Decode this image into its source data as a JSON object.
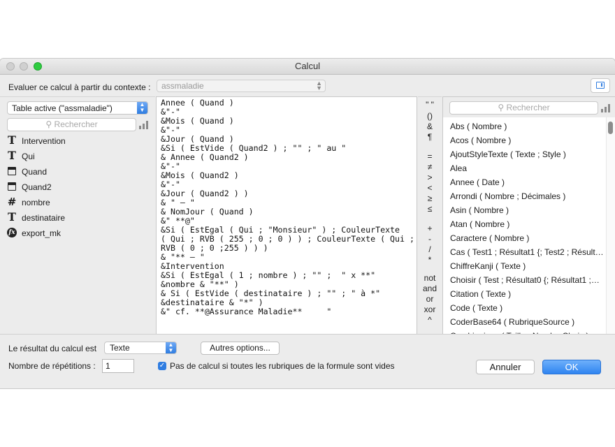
{
  "window": {
    "title": "Calcul"
  },
  "context": {
    "label": "Evaluer ce calcul à partir du contexte :",
    "value": "assmaladie"
  },
  "left": {
    "table_select": "Table active (\"assmaladie\")",
    "search_placeholder": "Rechercher",
    "fields": [
      {
        "icon": "text-field-icon",
        "label": "Intervention"
      },
      {
        "icon": "text-field-icon",
        "label": "Qui"
      },
      {
        "icon": "date-field-icon",
        "label": "Quand"
      },
      {
        "icon": "date-field-icon",
        "label": "Quand2"
      },
      {
        "icon": "number-field-icon",
        "label": "nombre"
      },
      {
        "icon": "text-field-icon",
        "label": "destinataire"
      },
      {
        "icon": "formula-field-icon",
        "label": "export_mk"
      }
    ]
  },
  "editor": {
    "lines": [
      "Annee ( Quand )",
      "&\"-\"",
      "&Mois ( Quand )",
      "&\"-\"",
      "&Jour ( Quand )",
      "&Si ( EstVide ( Quand2 ) ; \"\" ; \" au \"",
      "& Annee ( Quand2 )",
      "&\"-\"",
      "&Mois ( Quand2 )",
      "&\"-\"",
      "&Jour ( Quand2 ) )",
      "& \" – \"",
      "& NomJour ( Quand )",
      "&\" **@\"",
      "&Si ( EstEgal ( Qui ; \"Monsieur\" ) ; CouleurTexte",
      "( Qui ; RVB ( 255 ; 0 ; 0 ) ) ; CouleurTexte ( Qui ;",
      "RVB ( 0 ; 0 ;255 ) ) )",
      "& \"** – \"",
      "&Intervention",
      "&Si ( EstEgal ( 1 ; nombre ) ; \"\" ;  \" x **\"",
      "&nombre & \"**\" )",
      "& Si ( EstVide ( destinataire ) ; \"\" ; \" à *\"",
      "&destinataire & \"*\" )",
      "&\" cf. **@Assurance Maladie**     \""
    ]
  },
  "operators": [
    "\" \"",
    "()",
    "&",
    "¶",
    "=",
    "≠",
    ">",
    "<",
    "≥",
    "≤",
    "+",
    "-",
    "/",
    "*",
    "not",
    "and",
    "or",
    "xor",
    "^"
  ],
  "right": {
    "search_placeholder": "Rechercher",
    "functions": [
      "Abs ( Nombre )",
      "Acos ( Nombre )",
      "AjoutStyleTexte ( Texte ; Style )",
      "Alea",
      "Annee ( Date )",
      "Arrondi ( Nombre ; Décimales )",
      "Asin ( Nombre )",
      "Atan ( Nombre )",
      "Caractere ( Nombre )",
      "Cas ( Test1 ; Résultat1 {; Test2 ; Résult…",
      "ChiffreKanji ( Texte )",
      "Choisir ( Test ; Résultat0 {; Résultat1 ;…",
      "Citation ( Texte )",
      "Code ( Texte )",
      "CoderBase64 ( RubriqueSource )",
      "Combinaison ( Taille ; NombreChoix )"
    ]
  },
  "bottom": {
    "result_label": "Le résultat du calcul est",
    "result_type": "Texte",
    "more_options": "Autres options...",
    "repeat_label": "Nombre de répétitions :",
    "repeat_value": "1",
    "checkbox_label": "Pas de calcul si toutes les rubriques de la formule sont vides",
    "checkbox_checked": true,
    "cancel": "Annuler",
    "ok": "OK"
  },
  "colors": {
    "accent": "#2f7de1",
    "window_bg": "#ececec"
  }
}
